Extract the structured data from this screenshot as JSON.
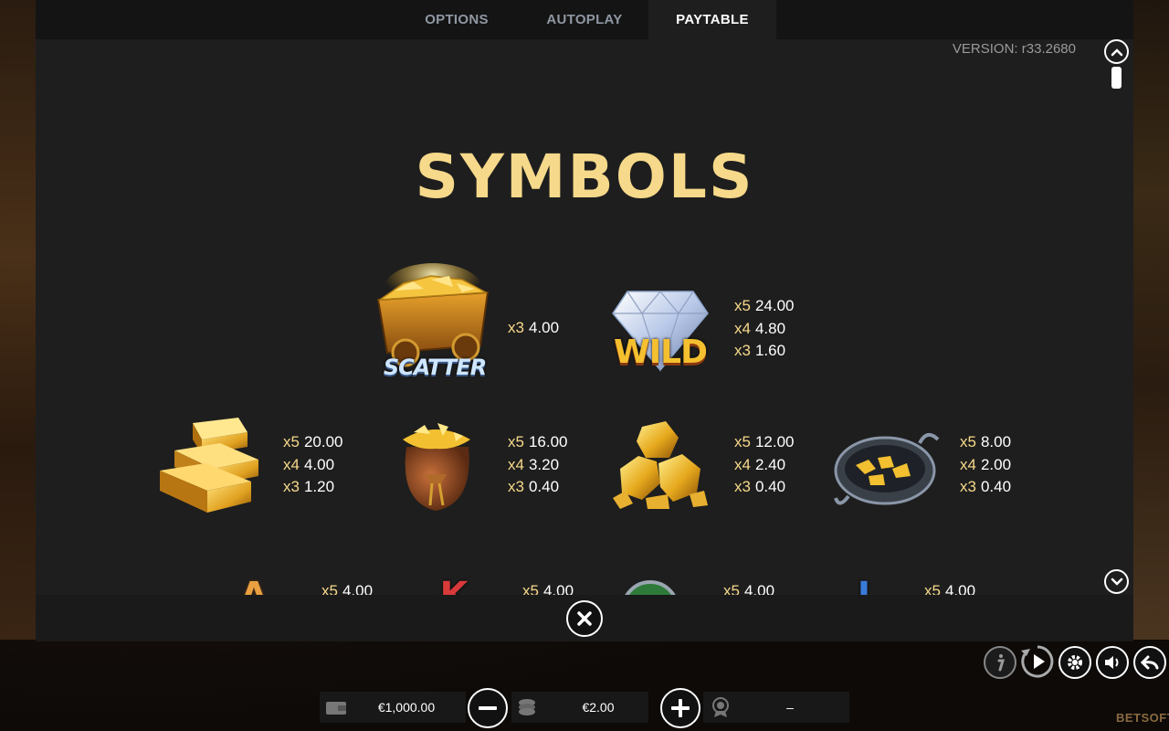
{
  "tabs": [
    {
      "label": "OPTIONS"
    },
    {
      "label": "AUTOPLAY"
    },
    {
      "label": "PAYTABLE"
    }
  ],
  "version": "VERSION: r33.2680",
  "section_title": "SYMBOLS",
  "symbols_row1": [
    {
      "name": "scatter",
      "badge": "SCATTER",
      "pays": [
        {
          "mul": "x3",
          "val": "4.00"
        }
      ]
    },
    {
      "name": "wild",
      "badge": "WILD",
      "pays": [
        {
          "mul": "x5",
          "val": "24.00"
        },
        {
          "mul": "x4",
          "val": "4.80"
        },
        {
          "mul": "x3",
          "val": "1.60"
        }
      ]
    }
  ],
  "symbols_row2": [
    {
      "name": "gold-bars",
      "pays": [
        {
          "mul": "x5",
          "val": "20.00"
        },
        {
          "mul": "x4",
          "val": "4.00"
        },
        {
          "mul": "x3",
          "val": "1.20"
        }
      ]
    },
    {
      "name": "gold-sack",
      "pays": [
        {
          "mul": "x5",
          "val": "16.00"
        },
        {
          "mul": "x4",
          "val": "3.20"
        },
        {
          "mul": "x3",
          "val": "0.40"
        }
      ]
    },
    {
      "name": "gold-nuggets",
      "pays": [
        {
          "mul": "x5",
          "val": "12.00"
        },
        {
          "mul": "x4",
          "val": "2.40"
        },
        {
          "mul": "x3",
          "val": "0.40"
        }
      ]
    },
    {
      "name": "gold-pan",
      "pays": [
        {
          "mul": "x5",
          "val": "8.00"
        },
        {
          "mul": "x4",
          "val": "2.00"
        },
        {
          "mul": "x3",
          "val": "0.40"
        }
      ]
    }
  ],
  "symbols_row3": [
    {
      "name": "letter-a",
      "glyph": "A",
      "pays": [
        {
          "mul": "x5",
          "val": "4.00"
        }
      ]
    },
    {
      "name": "letter-k",
      "glyph": "K",
      "pays": [
        {
          "mul": "x5",
          "val": "4.00"
        }
      ]
    },
    {
      "name": "letter-q",
      "glyph": "",
      "pays": [
        {
          "mul": "x5",
          "val": "4.00"
        }
      ]
    },
    {
      "name": "letter-j",
      "glyph": "J",
      "pays": [
        {
          "mul": "x5",
          "val": "4.00"
        }
      ]
    }
  ],
  "balance": "€1,000.00",
  "bet": "€2.00",
  "win": "–",
  "brand": "BETSOFT",
  "colors": {
    "accent_gold": "#f6d98a",
    "panel": "#1e1e1e",
    "tabbar": "#141414"
  }
}
